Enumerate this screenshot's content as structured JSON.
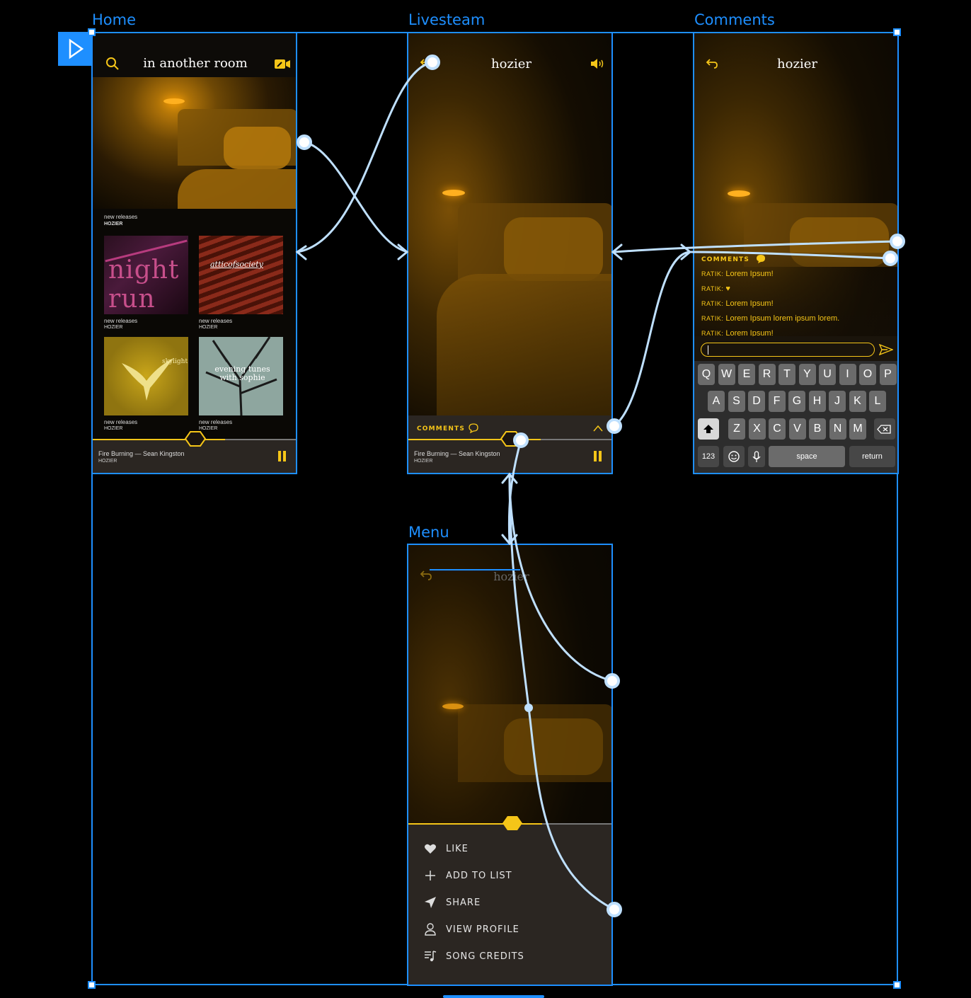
{
  "canvas": {
    "frames": {
      "home": "Home",
      "livestream": "Livesteam",
      "comments": "Comments",
      "menu": "Menu"
    }
  },
  "home": {
    "title": "in another room",
    "hero_caption": "new releases",
    "hero_artist": "HOZIER",
    "albums": [
      {
        "art_text": "night run",
        "caption": "new releases",
        "artist": "HOZIER"
      },
      {
        "art_text": "atticofsociety",
        "caption": "new releases",
        "artist": "HOZIER"
      },
      {
        "art_text": "skylight",
        "caption": "new releases",
        "artist": "HOZIER"
      },
      {
        "art_text": "evening tunes with sophie",
        "caption": "new releases",
        "artist": "HOZIER"
      }
    ],
    "player": {
      "track": "Fire Burning — Sean Kingston",
      "artist": "HOZIER",
      "progress": 0.65
    }
  },
  "livestream": {
    "title": "hozier",
    "comments_label": "COMMENTS",
    "player": {
      "track": "Fire Burning — Sean Kingston",
      "artist": "HOZIER",
      "progress": 0.65
    }
  },
  "comments": {
    "title": "hozier",
    "comments_label": "COMMENTS",
    "messages": [
      {
        "user": "RATIK:",
        "text": "Lorem Ipsum!"
      },
      {
        "user": "RATIK:",
        "text": "♥"
      },
      {
        "user": "RATIK:",
        "text": "Lorem Ipsum!"
      },
      {
        "user": "RATIK:",
        "text": "Lorem Ipsum lorem ipsum lorem."
      },
      {
        "user": "RATIK:",
        "text": "Lorem Ipsum!"
      }
    ],
    "input_value": "",
    "keyboard": {
      "row1": [
        "Q",
        "W",
        "E",
        "R",
        "T",
        "Y",
        "U",
        "I",
        "O",
        "P"
      ],
      "row2": [
        "A",
        "S",
        "D",
        "F",
        "G",
        "H",
        "J",
        "K",
        "L"
      ],
      "row3": [
        "Z",
        "X",
        "C",
        "V",
        "B",
        "N",
        "M"
      ],
      "numbers": "123",
      "space": "space",
      "return": "return"
    }
  },
  "menu": {
    "title": "hozier",
    "items": [
      "LIKE",
      "ADD TO LIST",
      "SHARE",
      "VIEW PROFILE",
      "SONG CREDITS"
    ]
  },
  "colors": {
    "accent": "#F5C518",
    "selection": "#1E8FFF",
    "connector": "#BFE0FF"
  }
}
